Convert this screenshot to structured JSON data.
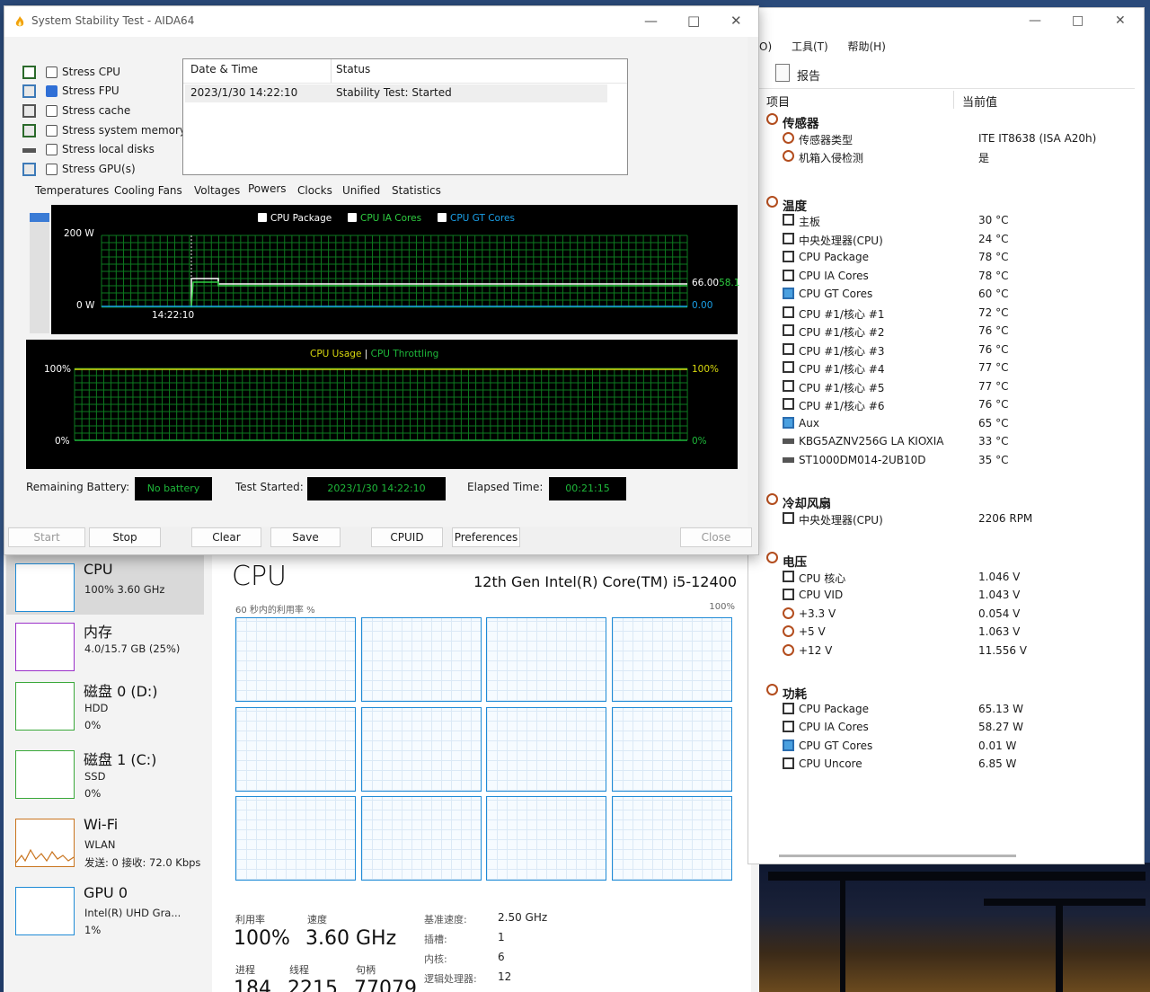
{
  "aida": {
    "title": "System Stability Test - AIDA64",
    "stress_items": [
      {
        "label": "Stress CPU",
        "checked": false
      },
      {
        "label": "Stress FPU",
        "checked": true
      },
      {
        "label": "Stress cache",
        "checked": false
      },
      {
        "label": "Stress system memory",
        "checked": false
      },
      {
        "label": "Stress local disks",
        "checked": false
      },
      {
        "label": "Stress GPU(s)",
        "checked": false
      }
    ],
    "status_table": {
      "headers": [
        "Date & Time",
        "Status"
      ],
      "rows": [
        [
          "2023/1/30 14:22:10",
          "Stability Test: Started"
        ]
      ]
    },
    "tabs": [
      "Temperatures",
      "Cooling Fans",
      "Voltages",
      "Powers",
      "Clocks",
      "Unified",
      "Statistics"
    ],
    "active_tab": "Powers",
    "power_chart": {
      "legend": [
        "CPU Package",
        "CPU IA Cores",
        "CPU GT Cores"
      ],
      "y_top": "200 W",
      "y_bottom": "0 W",
      "x_label": "14:22:10",
      "right_value_1": "66.00",
      "right_value_1_tail": "58.1",
      "right_value_2": "0.00",
      "colors": {
        "package": "#ffffff",
        "ia": "#2ecc40",
        "gt": "#1aa0e8",
        "grid": "#0d7a1f"
      }
    },
    "usage_chart": {
      "legend_a": "CPU Usage",
      "legend_sep": "|",
      "legend_b": "CPU Throttling",
      "y_top": "100%",
      "y_bottom": "0%",
      "right_top": "100%",
      "right_bottom": "0%"
    },
    "info": {
      "remaining_label": "Remaining Battery:",
      "remaining_value": "No battery",
      "started_label": "Test Started:",
      "started_value": "2023/1/30 14:22:10",
      "elapsed_label": "Elapsed Time:",
      "elapsed_value": "00:21:15"
    },
    "buttons": {
      "start": "Start",
      "stop": "Stop",
      "clear": "Clear",
      "save": "Save",
      "cpuid": "CPUID",
      "prefs": "Preferences",
      "close": "Close"
    }
  },
  "sensors": {
    "menu": [
      "O)",
      "工具(T)",
      "帮助(H)"
    ],
    "toolbar_report": "报告",
    "col_item": "项目",
    "col_value": "当前值",
    "groups": [
      {
        "name": "传感器",
        "icon": "sensor-icon",
        "rows": [
          {
            "name": "传感器类型",
            "value": "ITE IT8638  (ISA A20h)",
            "icon": "sensor-icon"
          },
          {
            "name": "机箱入侵检测",
            "value": "是",
            "icon": "shield-icon"
          }
        ]
      },
      {
        "name": "温度",
        "icon": "thermometer-icon",
        "rows": [
          {
            "name": "主板",
            "value": "30 °C",
            "icon": "motherboard-icon"
          },
          {
            "name": "中央处理器(CPU)",
            "value": "24 °C",
            "icon": "chip-icon"
          },
          {
            "name": "CPU Package",
            "value": "78 °C",
            "icon": "chip-icon"
          },
          {
            "name": "CPU IA Cores",
            "value": "78 °C",
            "icon": "chip-icon"
          },
          {
            "name": "CPU GT Cores",
            "value": "60 °C",
            "icon": "gpu-icon"
          },
          {
            "name": "CPU #1/核心 #1",
            "value": "72 °C",
            "icon": "chip-icon"
          },
          {
            "name": "CPU #1/核心 #2",
            "value": "76 °C",
            "icon": "chip-icon"
          },
          {
            "name": "CPU #1/核心 #3",
            "value": "76 °C",
            "icon": "chip-icon"
          },
          {
            "name": "CPU #1/核心 #4",
            "value": "77 °C",
            "icon": "chip-icon"
          },
          {
            "name": "CPU #1/核心 #5",
            "value": "77 °C",
            "icon": "chip-icon"
          },
          {
            "name": "CPU #1/核心 #6",
            "value": "76 °C",
            "icon": "chip-icon"
          },
          {
            "name": "Aux",
            "value": "65 °C",
            "icon": "monitor-icon"
          },
          {
            "name": "KBG5AZNV256G LA KIOXIA",
            "value": "33 °C",
            "icon": "drive-icon"
          },
          {
            "name": "ST1000DM014-2UB10D",
            "value": "35 °C",
            "icon": "drive-icon"
          }
        ]
      },
      {
        "name": "冷却风扇",
        "icon": "fan-icon",
        "rows": [
          {
            "name": "中央处理器(CPU)",
            "value": "2206 RPM",
            "icon": "chip-icon"
          }
        ]
      },
      {
        "name": "电压",
        "icon": "voltage-icon",
        "rows": [
          {
            "name": "CPU 核心",
            "value": "1.046 V",
            "icon": "chip-icon"
          },
          {
            "name": "CPU VID",
            "value": "1.043 V",
            "icon": "chip-icon"
          },
          {
            "name": "+3.3 V",
            "value": "0.054 V",
            "icon": "voltage-icon"
          },
          {
            "name": "+5 V",
            "value": "1.063 V",
            "icon": "voltage-icon"
          },
          {
            "name": "+12 V",
            "value": "11.556 V",
            "icon": "voltage-icon"
          }
        ]
      },
      {
        "name": "功耗",
        "icon": "power-icon",
        "rows": [
          {
            "name": "CPU Package",
            "value": "65.13 W",
            "icon": "chip-icon"
          },
          {
            "name": "CPU IA Cores",
            "value": "58.27 W",
            "icon": "chip-icon"
          },
          {
            "name": "CPU GT Cores",
            "value": "0.01 W",
            "icon": "gpu-icon"
          },
          {
            "name": "CPU Uncore",
            "value": "6.85 W",
            "icon": "chip-icon"
          }
        ]
      }
    ]
  },
  "taskman": {
    "side": [
      {
        "title": "CPU",
        "sub": [
          "100%  3.60 GHz"
        ],
        "color": "#1f8bd6"
      },
      {
        "title": "内存",
        "sub": [
          "4.0/15.7 GB (25%)"
        ],
        "color": "#9b30c9"
      },
      {
        "title": "磁盘 0 (D:)",
        "sub": [
          "HDD",
          "0%"
        ],
        "color": "#3aa83a"
      },
      {
        "title": "磁盘 1 (C:)",
        "sub": [
          "SSD",
          "0%"
        ],
        "color": "#3aa83a"
      },
      {
        "title": "Wi-Fi",
        "sub": [
          "WLAN",
          "发送: 0  接收: 72.0 Kbps"
        ],
        "color": "#c9741e"
      },
      {
        "title": "GPU 0",
        "sub": [
          "Intel(R) UHD Gra...",
          "1%"
        ],
        "color": "#1f8bd6"
      }
    ],
    "cpu_title": "CPU",
    "cpu_model": "12th Gen Intel(R) Core(TM) i5-12400",
    "util_label": "60 秒内的利用率 %",
    "util_max": "100%",
    "stats": {
      "util_label": "利用率",
      "util_value": "100%",
      "speed_label": "速度",
      "speed_value": "3.60 GHz",
      "proc_label": "进程",
      "proc_value": "184",
      "thread_label": "线程",
      "thread_value": "2215",
      "handle_label": "句柄",
      "handle_value": "77079",
      "base_label": "基准速度:",
      "base_value": "2.50 GHz",
      "socket_label": "插槽:",
      "socket_value": "1",
      "core_label": "内核:",
      "core_value": "6",
      "lp_label": "逻辑处理器:",
      "lp_value": "12"
    }
  }
}
